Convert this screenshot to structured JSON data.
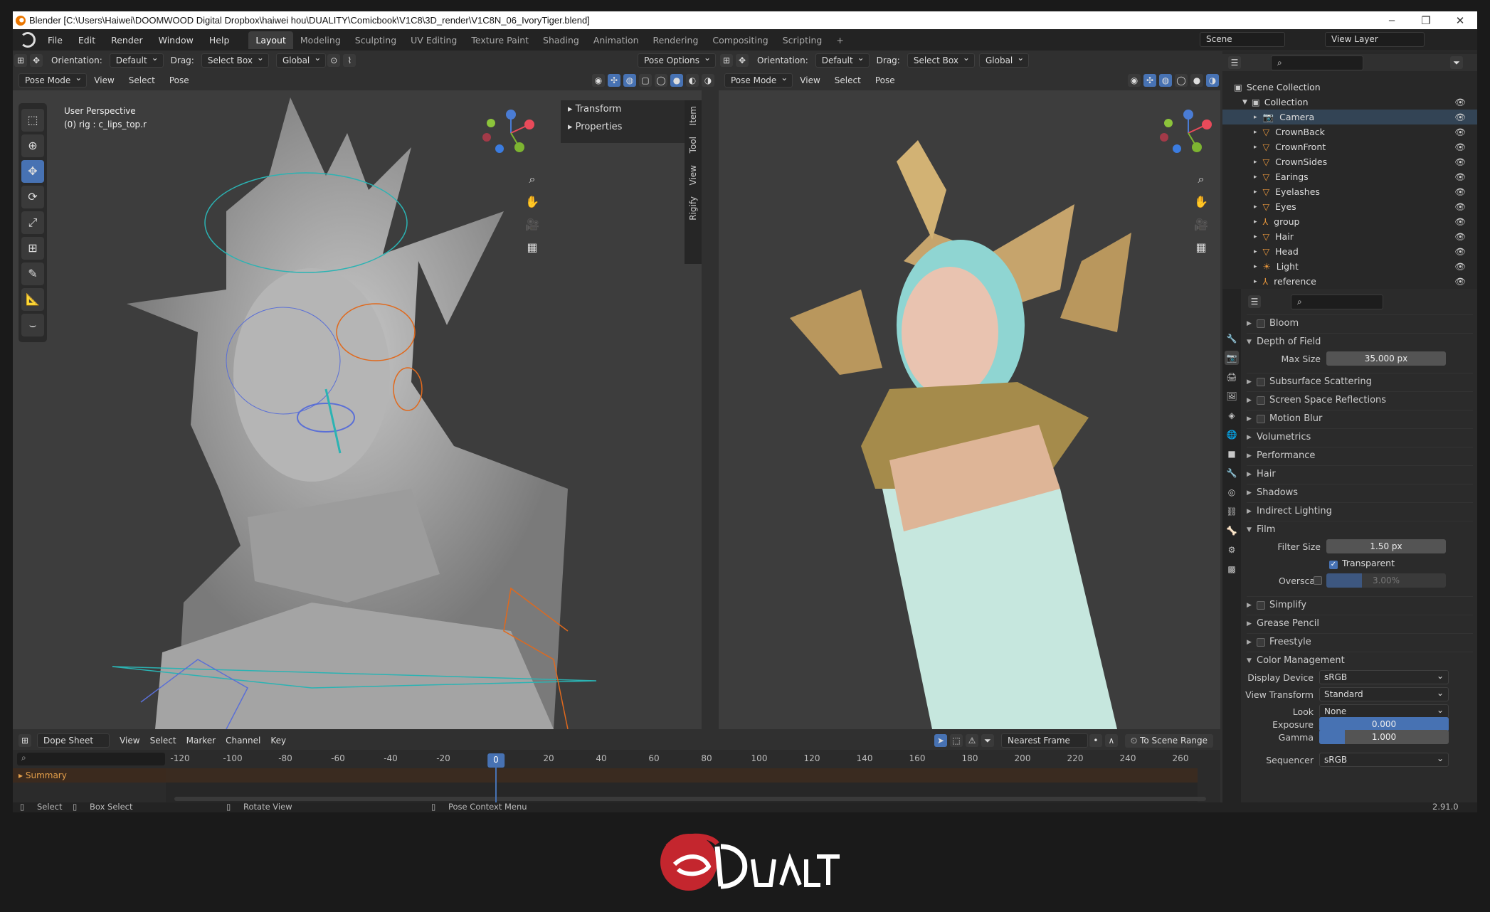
{
  "window": {
    "title": "Blender [C:\\Users\\Haiwei\\DOOMWOOD Digital Dropbox\\haiwei hou\\DUALITY\\Comicbook\\V1C8\\3D_render\\V1C8N_06_IvoryTiger.blend]"
  },
  "menu": [
    "File",
    "Edit",
    "Render",
    "Window",
    "Help"
  ],
  "workspaces": [
    "Layout",
    "Modeling",
    "Sculpting",
    "UV Editing",
    "Texture Paint",
    "Shading",
    "Animation",
    "Rendering",
    "Compositing",
    "Scripting"
  ],
  "active_workspace": "Layout",
  "scene": "Scene",
  "view_layer": "View Layer",
  "viewport_left": {
    "orientation_label": "Orientation:",
    "orientation": "Default",
    "drag_label": "Drag:",
    "drag": "Select Box",
    "transform": "Global",
    "mode": "Pose Mode",
    "menus": [
      "View",
      "Select",
      "Pose"
    ],
    "pose_options": "Pose Options",
    "perspective": "User Perspective",
    "object": "(0) rig : c_lips_top.r",
    "npanel": [
      "Transform",
      "Properties"
    ],
    "tabs": [
      "Item",
      "Tool",
      "View",
      "Rigify"
    ]
  },
  "viewport_right": {
    "orientation_label": "Orientation:",
    "orientation": "Default",
    "drag_label": "Drag:",
    "drag": "Select Box",
    "transform": "Global",
    "mode": "Pose Mode",
    "menus": [
      "View",
      "Select",
      "Pose"
    ]
  },
  "outliner": {
    "root": "Scene Collection",
    "collection": "Collection",
    "items": [
      "Camera",
      "CrownBack",
      "CrownFront",
      "CrownSides",
      "Earings",
      "Eyelashes",
      "Eyes",
      "group",
      "Hair",
      "Head",
      "Light",
      "reference"
    ]
  },
  "properties": {
    "sections": [
      "Bloom",
      "Depth of Field",
      "Subsurface Scattering",
      "Screen Space Reflections",
      "Motion Blur",
      "Volumetrics",
      "Performance",
      "Hair",
      "Shadows",
      "Indirect Lighting",
      "Film",
      "Simplify",
      "Grease Pencil",
      "Freestyle",
      "Color Management"
    ],
    "max_size_label": "Max Size",
    "max_size": "35.000 px",
    "filter_size_label": "Filter Size",
    "filter_size": "1.50 px",
    "transparent_label": "Transparent",
    "overscan_label": "Overscan",
    "overscan": "3.00%",
    "overscan_fraction": 0.3,
    "display_device_label": "Display Device",
    "display_device": "sRGB",
    "view_transform_label": "View Transform",
    "view_transform": "Standard",
    "look_label": "Look",
    "look": "None",
    "exposure_label": "Exposure",
    "exposure": "0.000",
    "gamma_label": "Gamma",
    "gamma": "1.000",
    "gamma_fraction": 0.2,
    "sequencer_label": "Sequencer",
    "sequencer": "sRGB"
  },
  "dopesheet": {
    "editor": "Dope Sheet",
    "menus": [
      "View",
      "Select",
      "Marker",
      "Channel",
      "Key"
    ],
    "snap": "Nearest Frame",
    "scene_range": "To Scene Range",
    "summary": "Summary",
    "ruler": [
      "-120",
      "-100",
      "-80",
      "-60",
      "-40",
      "-20",
      "0",
      "20",
      "40",
      "60",
      "80",
      "100",
      "120",
      "140",
      "160",
      "180",
      "200",
      "220",
      "240",
      "260"
    ],
    "current_frame": "0"
  },
  "status": {
    "select": "Select",
    "box_select": "Box Select",
    "rotate_view": "Rotate View",
    "pose_context": "Pose Context Menu",
    "version": "2.91.0"
  },
  "colors": {
    "accent": "#4772b3",
    "orange_bones": "#e0691d",
    "blue_bones": "#5a6fd6",
    "teal_bones": "#2bb3b3"
  }
}
